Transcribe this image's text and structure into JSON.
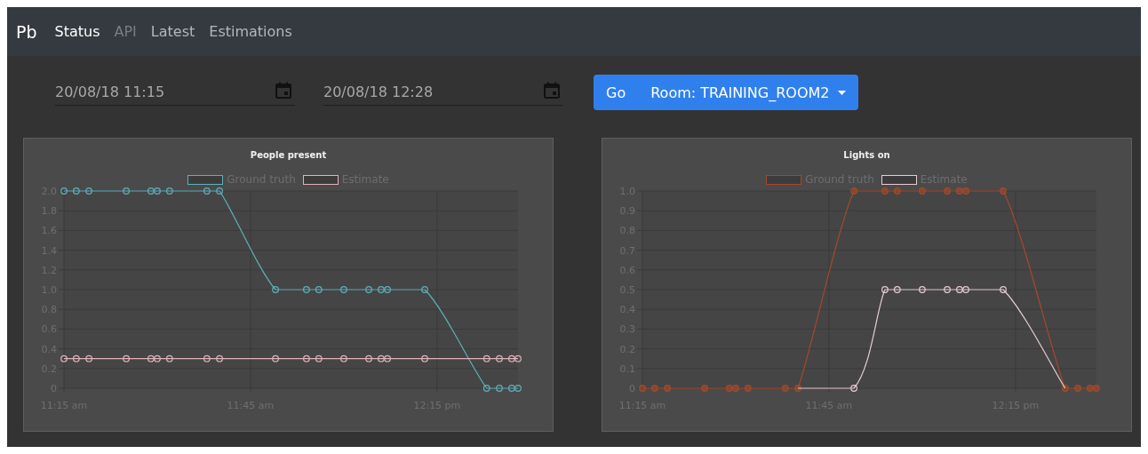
{
  "navbar": {
    "brand": "Pb",
    "items": [
      {
        "label": "Status",
        "selected": true,
        "disabled": false
      },
      {
        "label": "API",
        "selected": false,
        "disabled": true
      },
      {
        "label": "Latest",
        "selected": false,
        "disabled": false
      },
      {
        "label": "Estimations",
        "selected": false,
        "disabled": false
      }
    ]
  },
  "filters": {
    "start": {
      "value": "20/08/18 11:15"
    },
    "end": {
      "value": "20/08/18 12:28"
    },
    "go_button": "Go",
    "room_dropdown": "Room: TRAINING_ROOM2"
  },
  "charts": [
    {
      "chart_data": {
        "type": "line",
        "grid": true,
        "title": "People present",
        "x": [
          11.25,
          11.283,
          11.317,
          11.417,
          11.483,
          11.5,
          11.533,
          11.633,
          11.667,
          11.817,
          11.9,
          11.933,
          12,
          12.067,
          12.1,
          12.117,
          12.217,
          12.383,
          12.417,
          12.45,
          12.467
        ],
        "xlim": [
          11.25,
          12.467
        ],
        "ylim": [
          0,
          2
        ],
        "xticks": [
          {
            "value": 11.25,
            "label": "11:15 am"
          },
          {
            "value": 11.75,
            "label": "11:45 am"
          },
          {
            "value": 12.25,
            "label": "12:15 pm"
          }
        ],
        "yticks": [
          {
            "value": 0,
            "label": "0"
          },
          {
            "value": 0.2,
            "label": "0.2"
          },
          {
            "value": 0.4,
            "label": "0.4"
          },
          {
            "value": 0.6,
            "label": "0.6"
          },
          {
            "value": 0.8,
            "label": "0.8"
          },
          {
            "value": 1,
            "label": "1.0"
          },
          {
            "value": 1.2,
            "label": "1.2"
          },
          {
            "value": 1.4,
            "label": "1.4"
          },
          {
            "value": 1.6,
            "label": "1.6"
          },
          {
            "value": 1.8,
            "label": "1.8"
          },
          {
            "value": 2,
            "label": "2.0"
          }
        ],
        "series": [
          {
            "name": "Ground truth",
            "color": "#5fb0bb",
            "marker": "circle",
            "values": [
              2,
              2,
              2,
              2,
              2,
              2,
              2,
              2,
              2,
              1,
              1,
              1,
              1,
              1,
              1,
              1,
              1,
              0,
              0,
              0,
              0
            ]
          },
          {
            "name": "Estimate",
            "color": "#e0b3bb",
            "marker": "circle",
            "values": [
              0.3,
              0.3,
              0.3,
              0.3,
              0.3,
              0.3,
              0.3,
              0.3,
              0.3,
              0.3,
              0.3,
              0.3,
              0.3,
              0.3,
              0.3,
              0.3,
              0.3,
              0.3,
              0.3,
              0.3,
              0.3
            ]
          }
        ]
      }
    },
    {
      "chart_data": {
        "type": "line",
        "grid": true,
        "title": "Lights on",
        "x": [
          11.25,
          11.283,
          11.317,
          11.417,
          11.483,
          11.5,
          11.533,
          11.633,
          11.667,
          11.817,
          11.9,
          11.933,
          12,
          12.067,
          12.1,
          12.117,
          12.217,
          12.383,
          12.417,
          12.45,
          12.467
        ],
        "xlim": [
          11.25,
          12.467
        ],
        "ylim": [
          0,
          1
        ],
        "xticks": [
          {
            "value": 11.25,
            "label": "11:15 am"
          },
          {
            "value": 11.75,
            "label": "11:45 am"
          },
          {
            "value": 12.25,
            "label": "12:15 pm"
          }
        ],
        "yticks": [
          {
            "value": 0,
            "label": "0"
          },
          {
            "value": 0.1,
            "label": "0.1"
          },
          {
            "value": 0.2,
            "label": "0.2"
          },
          {
            "value": 0.3,
            "label": "0.3"
          },
          {
            "value": 0.4,
            "label": "0.4"
          },
          {
            "value": 0.5,
            "label": "0.5"
          },
          {
            "value": 0.6,
            "label": "0.6"
          },
          {
            "value": 0.7,
            "label": "0.7"
          },
          {
            "value": 0.8,
            "label": "0.8"
          },
          {
            "value": 0.9,
            "label": "0.9"
          },
          {
            "value": 1,
            "label": "1.0"
          }
        ],
        "series": [
          {
            "name": "Ground truth",
            "color": "#a5492b",
            "marker": "circle",
            "values": [
              0,
              0,
              0,
              0,
              0,
              0,
              0,
              0,
              0,
              1,
              1,
              1,
              1,
              1,
              1,
              1,
              1,
              0,
              0,
              0,
              0
            ]
          },
          {
            "name": "Estimate",
            "color": "#e8ccd3",
            "marker": "circle",
            "values": [
              null,
              null,
              null,
              null,
              null,
              null,
              null,
              null,
              0,
              0,
              0.5,
              0.5,
              0.5,
              0.5,
              0.5,
              0.5,
              0.5,
              0,
              null,
              null,
              null
            ]
          }
        ]
      }
    }
  ]
}
